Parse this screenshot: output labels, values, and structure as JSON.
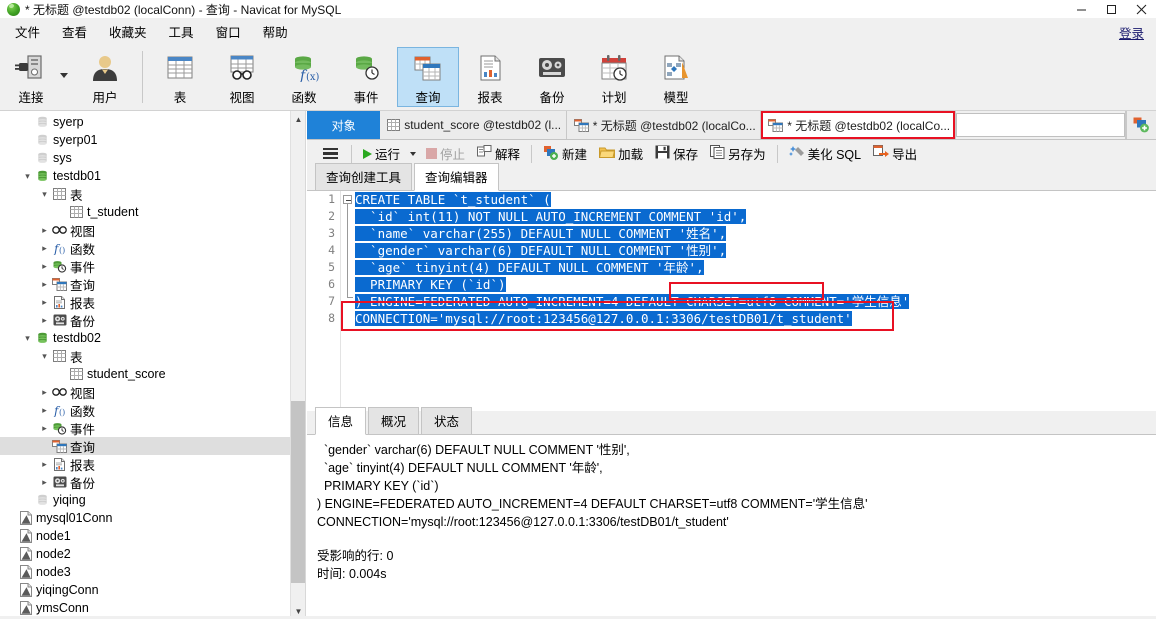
{
  "window": {
    "title": "* 无标题 @testdb02 (localConn) - 查询 - Navicat for MySQL",
    "logo_icon": "navicat-logo-icon",
    "minimize_icon": "minimize-icon",
    "maximize_icon": "maximize-icon",
    "close_icon": "close-icon"
  },
  "menubar": {
    "items": [
      {
        "label": "文件"
      },
      {
        "label": "查看"
      },
      {
        "label": "收藏夹"
      },
      {
        "label": "工具"
      },
      {
        "label": "窗口"
      },
      {
        "label": "帮助"
      }
    ],
    "login_label": "登录"
  },
  "toolbar": {
    "items": [
      {
        "label": "连接",
        "icon": "connection-icon",
        "selected": false,
        "has_dropdown": true
      },
      {
        "label": "用户",
        "icon": "user-icon",
        "selected": false
      },
      {
        "label": "表",
        "icon": "table-icon",
        "selected": false
      },
      {
        "label": "视图",
        "icon": "view-icon",
        "selected": false
      },
      {
        "label": "函数",
        "icon": "function-icon",
        "selected": false
      },
      {
        "label": "事件",
        "icon": "event-icon",
        "selected": false
      },
      {
        "label": "查询",
        "icon": "query-icon",
        "selected": true
      },
      {
        "label": "报表",
        "icon": "report-icon",
        "selected": false
      },
      {
        "label": "备份",
        "icon": "backup-icon",
        "selected": false
      },
      {
        "label": "计划",
        "icon": "schedule-icon",
        "selected": false
      },
      {
        "label": "模型",
        "icon": "model-icon",
        "selected": false
      }
    ]
  },
  "sidebar": {
    "nodes": [
      {
        "label": "syerp",
        "indent": 1,
        "chev": "",
        "icon": "database-gray-icon",
        "selected": false
      },
      {
        "label": "syerp01",
        "indent": 1,
        "chev": "",
        "icon": "database-gray-icon",
        "selected": false
      },
      {
        "label": "sys",
        "indent": 1,
        "chev": "",
        "icon": "database-gray-icon",
        "selected": false
      },
      {
        "label": "testdb01",
        "indent": 1,
        "chev": "v",
        "icon": "database-green-icon",
        "selected": false
      },
      {
        "label": "表",
        "indent": 2,
        "chev": "v",
        "icon": "table-icon",
        "selected": false
      },
      {
        "label": "t_student",
        "indent": 3,
        "chev": "",
        "icon": "table-icon",
        "selected": false
      },
      {
        "label": "视图",
        "indent": 2,
        "chev": ">",
        "icon": "view-icon",
        "selected": false
      },
      {
        "label": "函数",
        "indent": 2,
        "chev": ">",
        "icon": "function-icon",
        "selected": false
      },
      {
        "label": "事件",
        "indent": 2,
        "chev": ">",
        "icon": "event-icon",
        "selected": false
      },
      {
        "label": "查询",
        "indent": 2,
        "chev": ">",
        "icon": "query-icon",
        "selected": false
      },
      {
        "label": "报表",
        "indent": 2,
        "chev": ">",
        "icon": "report-icon",
        "selected": false
      },
      {
        "label": "备份",
        "indent": 2,
        "chev": ">",
        "icon": "backup-icon",
        "selected": false
      },
      {
        "label": "testdb02",
        "indent": 1,
        "chev": "v",
        "icon": "database-green-icon",
        "selected": false
      },
      {
        "label": "表",
        "indent": 2,
        "chev": "v",
        "icon": "table-icon",
        "selected": false
      },
      {
        "label": "student_score",
        "indent": 3,
        "chev": "",
        "icon": "table-icon",
        "selected": false
      },
      {
        "label": "视图",
        "indent": 2,
        "chev": ">",
        "icon": "view-icon",
        "selected": false
      },
      {
        "label": "函数",
        "indent": 2,
        "chev": ">",
        "icon": "function-icon",
        "selected": false
      },
      {
        "label": "事件",
        "indent": 2,
        "chev": ">",
        "icon": "event-icon",
        "selected": false
      },
      {
        "label": "查询",
        "indent": 2,
        "chev": "",
        "icon": "query-icon",
        "selected": true
      },
      {
        "label": "报表",
        "indent": 2,
        "chev": ">",
        "icon": "report-icon",
        "selected": false
      },
      {
        "label": "备份",
        "indent": 2,
        "chev": ">",
        "icon": "backup-icon",
        "selected": false
      },
      {
        "label": "yiqing",
        "indent": 1,
        "chev": "",
        "icon": "database-gray-icon",
        "selected": false
      },
      {
        "label": "mysql01Conn",
        "indent": 0,
        "chev": "",
        "icon": "connection-file-icon",
        "selected": false
      },
      {
        "label": "node1",
        "indent": 0,
        "chev": "",
        "icon": "connection-file-icon",
        "selected": false
      },
      {
        "label": "node2",
        "indent": 0,
        "chev": "",
        "icon": "connection-file-icon",
        "selected": false
      },
      {
        "label": "node3",
        "indent": 0,
        "chev": "",
        "icon": "connection-file-icon",
        "selected": false
      },
      {
        "label": "yiqingConn",
        "indent": 0,
        "chev": "",
        "icon": "connection-file-icon",
        "selected": false
      },
      {
        "label": "ymsConn",
        "indent": 0,
        "chev": "",
        "icon": "connection-file-icon",
        "selected": false
      }
    ],
    "scroll_up_icon": "scroll-up-arrow-icon",
    "scroll_down_icon": "scroll-down-arrow-icon"
  },
  "tabs": [
    {
      "label": "对象",
      "kind": "object",
      "icon": "",
      "active": false,
      "highlighted": false
    },
    {
      "label": "student_score @testdb02 (l...",
      "kind": "table",
      "icon": "table-icon",
      "active": false,
      "highlighted": false
    },
    {
      "label": "* 无标题 @testdb02 (localCo...",
      "kind": "query",
      "icon": "query-icon",
      "active": false,
      "highlighted": false
    },
    {
      "label": "* 无标题 @testdb02 (localCo...",
      "kind": "query",
      "icon": "query-icon",
      "active": true,
      "highlighted": true
    }
  ],
  "tab_new_icon": "new-query-tab-icon",
  "query_toolbar": {
    "menu_icon": "hamburger-menu-icon",
    "buttons": [
      {
        "label": "运行",
        "icon": "run-play-icon",
        "disabled": false,
        "dropdown": true
      },
      {
        "label": "停止",
        "icon": "stop-icon",
        "disabled": true,
        "dropdown": false
      },
      {
        "label": "解释",
        "icon": "explain-icon",
        "disabled": false,
        "dropdown": false
      },
      {
        "label": "新建",
        "icon": "new-file-icon",
        "disabled": false,
        "dropdown": false
      },
      {
        "label": "加载",
        "icon": "open-folder-icon",
        "disabled": false,
        "dropdown": false
      },
      {
        "label": "保存",
        "icon": "save-disk-icon",
        "disabled": false,
        "dropdown": false
      },
      {
        "label": "另存为",
        "icon": "save-as-icon",
        "disabled": false,
        "dropdown": false
      },
      {
        "label": "美化 SQL",
        "icon": "beautify-sql-icon",
        "disabled": false,
        "dropdown": false
      },
      {
        "label": "导出",
        "icon": "export-arrow-icon",
        "disabled": false,
        "dropdown": false
      }
    ]
  },
  "editor_tabs": [
    {
      "label": "查询创建工具",
      "active": false
    },
    {
      "label": "查询编辑器",
      "active": true
    }
  ],
  "editor": {
    "line_numbers": [
      "1",
      "2",
      "3",
      "4",
      "5",
      "6",
      "7",
      "8"
    ],
    "lines": [
      "CREATE TABLE `t_student` (",
      "  `id` int(11) NOT NULL AUTO_INCREMENT COMMENT 'id',",
      "  `name` varchar(255) DEFAULT NULL COMMENT '姓名',",
      "  `gender` varchar(6) DEFAULT NULL COMMENT '性别',",
      "  `age` tinyint(4) DEFAULT NULL COMMENT '年龄',",
      "  PRIMARY KEY (`id`)",
      ") ENGINE=FEDERATED AUTO_INCREMENT=4 DEFAULT CHARSET=utf8 COMMENT='学生信息'",
      "CONNECTION='mysql://root:123456@127.0.0.1:3306/testDB01/t_student'"
    ],
    "annotation_color": "#e81123",
    "selection_color": "#0a6ad0"
  },
  "result_tabs": [
    {
      "label": "信息",
      "active": true
    },
    {
      "label": "概况",
      "active": false
    },
    {
      "label": "状态",
      "active": false
    }
  ],
  "result_output": {
    "lines": [
      "  `gender` varchar(6) DEFAULT NULL COMMENT '性别',",
      "  `age` tinyint(4) DEFAULT NULL COMMENT '年龄',",
      "  PRIMARY KEY (`id`)",
      ") ENGINE=FEDERATED AUTO_INCREMENT=4 DEFAULT CHARSET=utf8 COMMENT='学生信息'",
      "CONNECTION='mysql://root:123456@127.0.0.1:3306/testDB01/t_student'"
    ],
    "affected_rows": "受影响的行: 0",
    "time": "时间: 0.004s"
  }
}
